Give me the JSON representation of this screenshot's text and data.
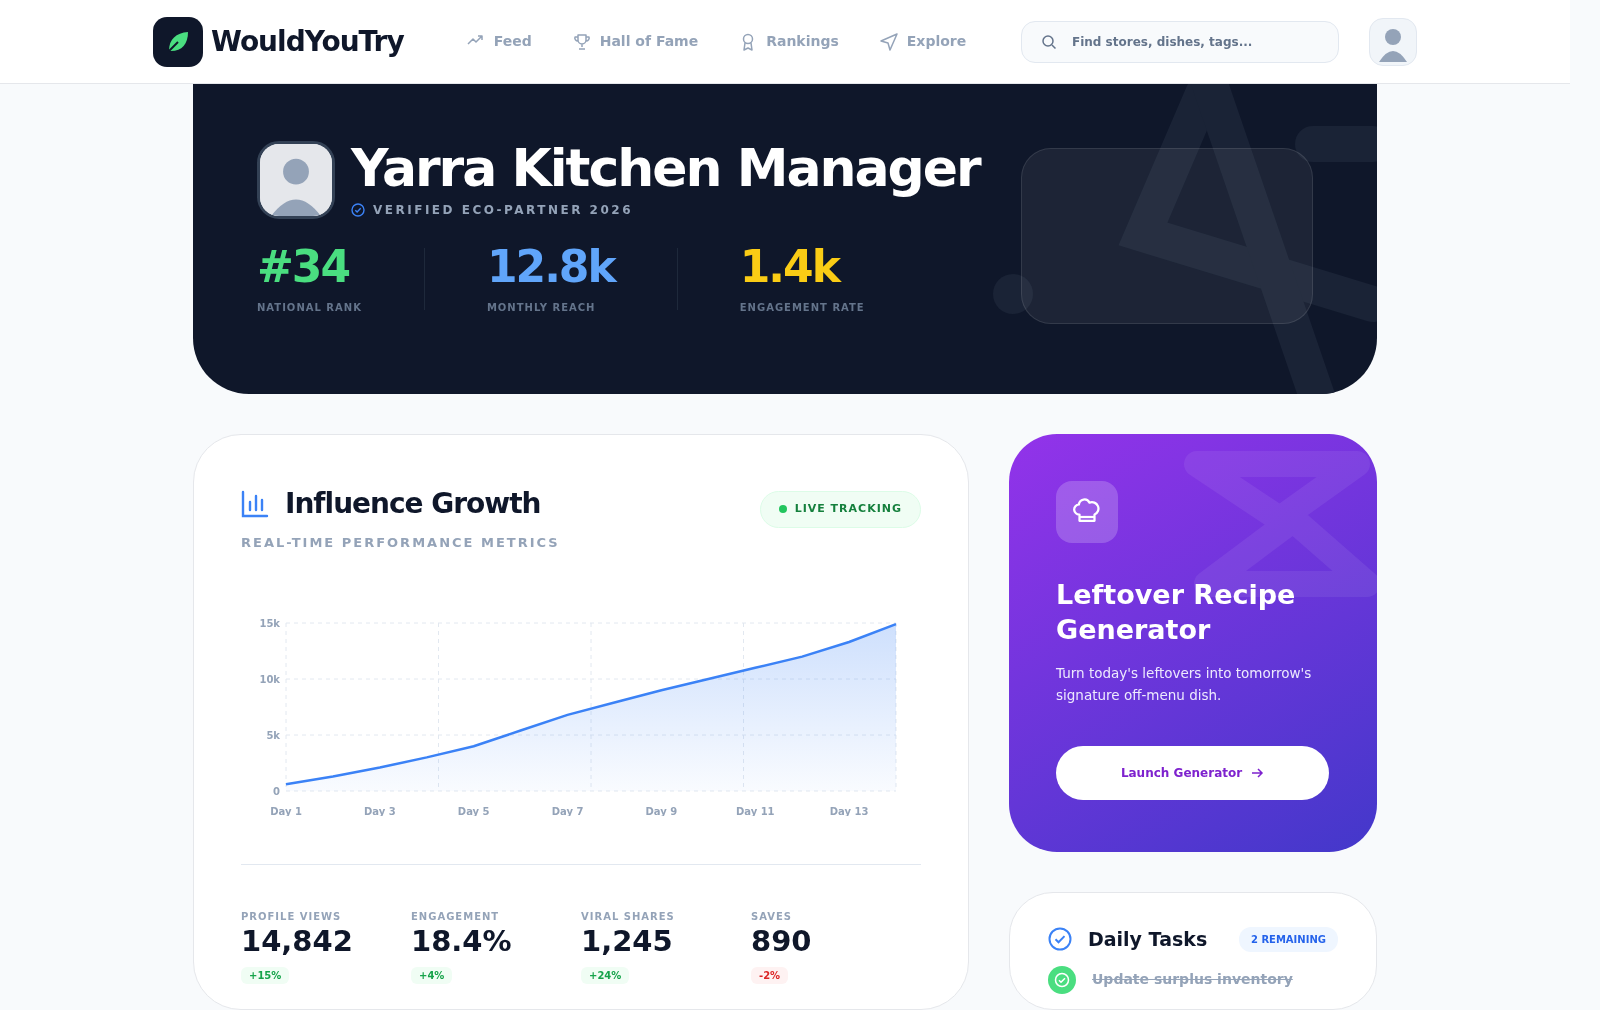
{
  "nav": {
    "brand": "WouldYouTry",
    "links": [
      {
        "label": "Feed",
        "kind": "trend",
        "selected": false
      },
      {
        "label": "Hall of Fame",
        "kind": "trophy",
        "selected": false
      },
      {
        "label": "Rankings",
        "kind": "award",
        "selected": false
      },
      {
        "label": "Explore",
        "kind": "send",
        "selected": false
      }
    ],
    "search": {
      "placeholder": "Find stores, dishes, tags..."
    }
  },
  "hero": {
    "name": "Yarra Kitchen Manager",
    "badge": "VERIFIED ECO-PARTNER 2026",
    "stats": [
      {
        "value": "#34",
        "label": "NATIONAL RANK",
        "color": "#4ade80"
      },
      {
        "value": "12.8k",
        "label": "MONTHLY REACH",
        "color": "#60a5fa"
      },
      {
        "value": "1.4k",
        "label": "ENGAGEMENT RATE",
        "color": "#facc15"
      }
    ]
  },
  "growth": {
    "title": "Influence Growth",
    "subtitle": "REAL-TIME PERFORMANCE METRICS",
    "status": "LIVE TRACKING",
    "chart_data": {
      "type": "area",
      "categories": [
        "Day 1",
        null,
        "Day 3",
        null,
        "Day 5",
        null,
        "Day 7",
        null,
        "Day 9",
        null,
        "Day 11",
        null,
        "Day 13",
        null
      ],
      "yticks": [
        {
          "value": 0,
          "label": "0"
        },
        {
          "value": 5000,
          "label": "5k"
        },
        {
          "value": 10000,
          "label": "10k"
        },
        {
          "value": 15000,
          "label": "15k"
        }
      ],
      "ylim": [
        0,
        15000
      ],
      "series": [
        {
          "color": "#3b82f6",
          "values": [
            600,
            1300,
            2100,
            3000,
            4000,
            5400,
            6800,
            7900,
            9000,
            10000,
            11000,
            12000,
            13300,
            14900
          ]
        }
      ]
    },
    "metrics": [
      {
        "label": "PROFILE VIEWS",
        "value": "14,842",
        "change": "+15%",
        "positive": true
      },
      {
        "label": "ENGAGEMENT",
        "value": "18.4%",
        "change": "+4%",
        "positive": true
      },
      {
        "label": "VIRAL SHARES",
        "value": "1,245",
        "change": "+24%",
        "positive": true
      },
      {
        "label": "SAVES",
        "value": "890",
        "change": "-2%",
        "positive": false
      }
    ]
  },
  "generator": {
    "title": "Leftover Recipe Generator",
    "description": "Turn today's leftovers into tomorrow's signature off-menu dish.",
    "button": "Launch Generator"
  },
  "tasks": {
    "title": "Daily Tasks",
    "count": "2 REMAINING",
    "items": [
      {
        "label": "Update surplus inventory",
        "checked": true
      }
    ]
  }
}
